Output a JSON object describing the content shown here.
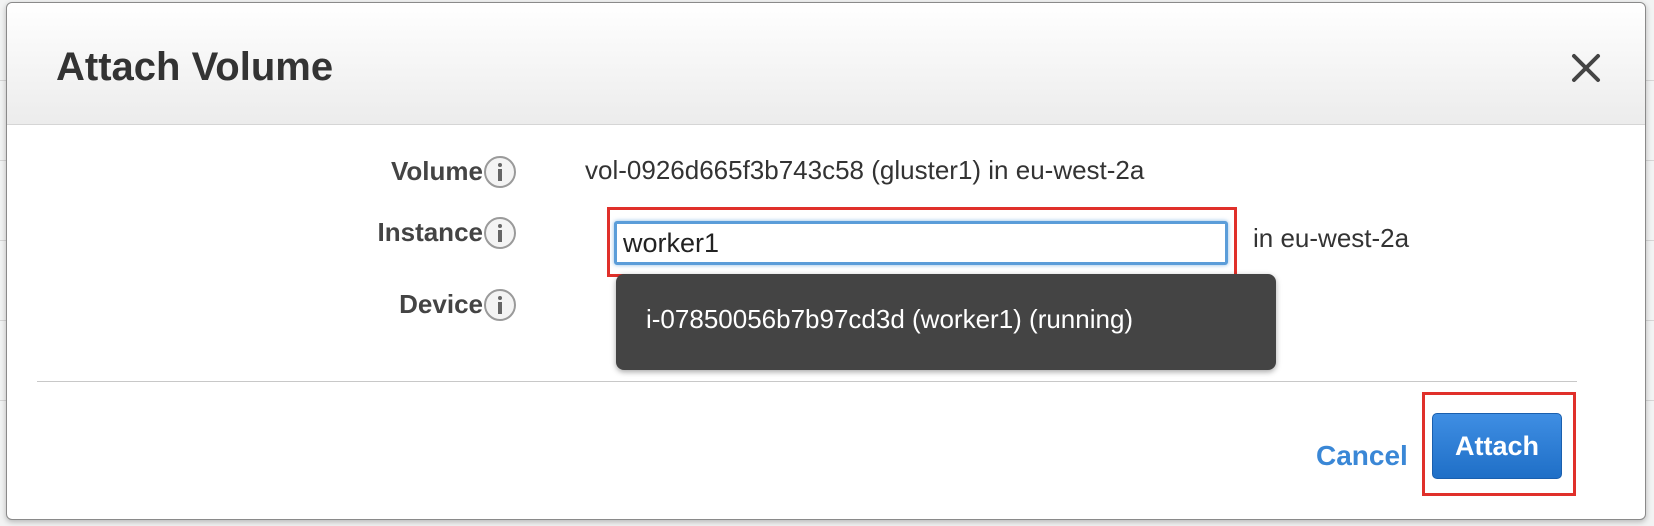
{
  "dialog": {
    "title": "Attach Volume",
    "close_icon": "close-icon"
  },
  "form": {
    "volume": {
      "label": "Volume",
      "value": "vol-0926d665f3b743c58 (gluster1) in eu-west-2a",
      "info_icon": "info-icon"
    },
    "instance": {
      "label": "Instance",
      "input_value": "worker1",
      "suffix": "in eu-west-2a",
      "info_icon": "info-icon"
    },
    "device": {
      "label": "Device",
      "info_icon": "info-icon"
    },
    "suggestions": [
      "i-07850056b7b97cd3d (worker1) (running)"
    ]
  },
  "footer": {
    "cancel_label": "Cancel",
    "attach_label": "Attach"
  },
  "colors": {
    "primary_button": "#2a7bd6",
    "link": "#3a87d6",
    "highlight_box": "#e0302a",
    "tooltip_bg": "#444444"
  }
}
